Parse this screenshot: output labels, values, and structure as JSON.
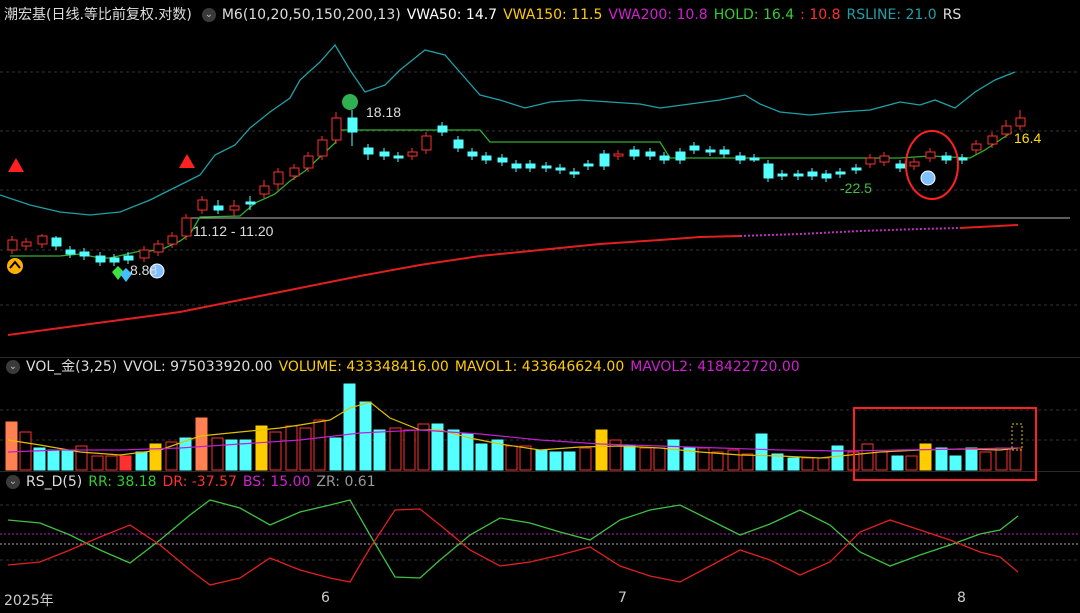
{
  "main_header": {
    "stock": "潮宏基(日线.等比前复权.对数)",
    "ma_label": "M6(10,20,50,150,200,13)",
    "vwa50": "VWA50: 14.7",
    "vwa150": "VWA150: 11.5",
    "vwa200": "VWA200: 10.8",
    "hold": "HOLD: 16.4",
    "hold2": ": 10.8",
    "rsline": "RSLINE: 21.0",
    "rs": "RS"
  },
  "vol_header": {
    "name": "VOL_金(3,25)",
    "vvol": "VVOL: 975033920.00",
    "volume": "VOLUME: 433348416.00",
    "mavol1": "MAVOL1: 433646624.00",
    "mavol2": "MAVOL2: 418422720.00"
  },
  "rs_header": {
    "name": "RS_D(5)",
    "rr": "RR: 38.18",
    "dr": "DR: -37.57",
    "bs": "BS: 15.00",
    "zr": "ZR: 0.61"
  },
  "annotations": {
    "high": "18.18",
    "low_range": "11.12 - 11.20",
    "low_mark": "8.88",
    "neg": "-22.5",
    "last": "16.4"
  },
  "x_axis": {
    "year": "2025年",
    "m6": "6",
    "m7": "7",
    "m8": "8"
  },
  "colors": {
    "up": "#ff3030",
    "down": "#54ffff",
    "green": "#00cc00",
    "yellow": "#ffcc00",
    "magenta": "#d020d0",
    "teal": "#1fa0a8"
  }
}
